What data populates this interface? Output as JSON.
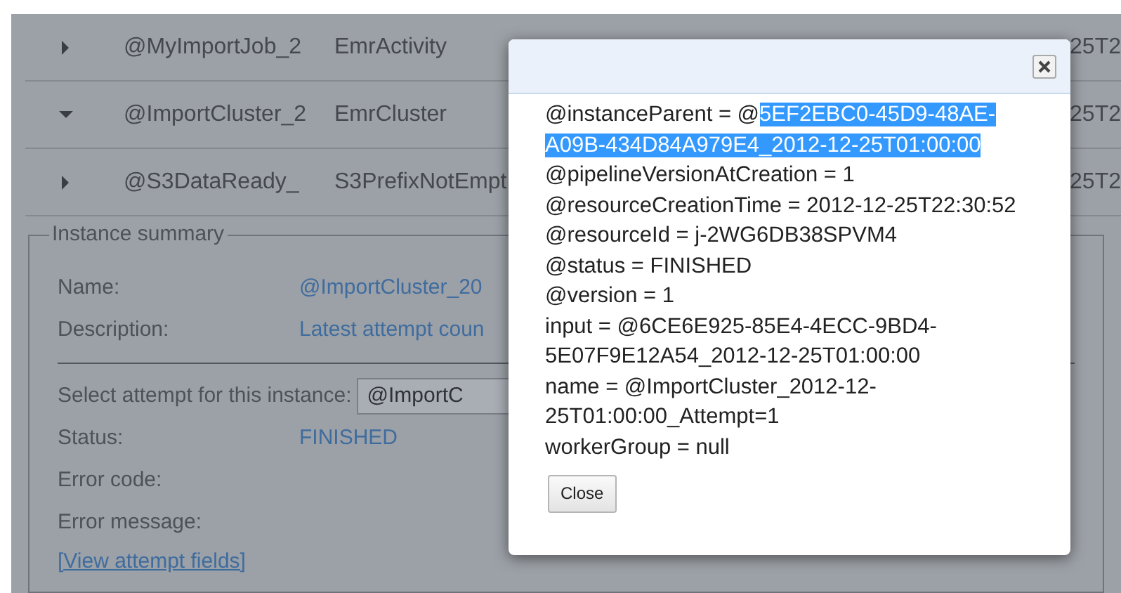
{
  "rows": [
    {
      "expanded": false,
      "name": "@MyImportJob_2",
      "type": "EmrActivity",
      "column_5": "25T2"
    },
    {
      "expanded": true,
      "name": "@ImportCluster_2",
      "type": "EmrCluster",
      "column_5": "25T2"
    },
    {
      "expanded": false,
      "name": "@S3DataReady_",
      "type": "S3PrefixNotEmpt",
      "column_5": "25T2"
    }
  ],
  "summary": {
    "legend": "Instance summary",
    "fields": [
      {
        "label": "Name:",
        "value": "@ImportCluster_20"
      },
      {
        "label": "Description:",
        "value": "Latest attempt coun"
      }
    ],
    "attempt_label": "Select attempt for this instance:",
    "attempt_value": "@ImportC",
    "details": [
      {
        "label": "Status:",
        "value": "FINISHED"
      },
      {
        "label": "Error code:"
      },
      {
        "label": "Error message:"
      }
    ],
    "link": "[View attempt fields]"
  },
  "dialog": {
    "lines": [
      {
        "text": "@instanceParent = @",
        "highlight": "5EF2EBC0-45D9-48AE-A09B-434D84A979E4_2012-12-25T01:00:00"
      },
      {
        "text": "@pipelineVersionAtCreation = 1"
      },
      {
        "text": "@resourceCreationTime = 2012-12-25T22:30:52"
      },
      {
        "text": "@resourceId = j-2WG6DB38SPVM4"
      },
      {
        "text": "@status = FINISHED"
      },
      {
        "text": "@version = 1"
      },
      {
        "text": "input = @6CE6E925-85E4-4ECC-9BD4-5E07F9E12A54_2012-12-25T01:00:00"
      },
      {
        "text": "name = @ImportCluster_2012-12-25T01:00:00_Attempt=1"
      },
      {
        "text": "workerGroup = null"
      }
    ],
    "close_button": "Close"
  }
}
